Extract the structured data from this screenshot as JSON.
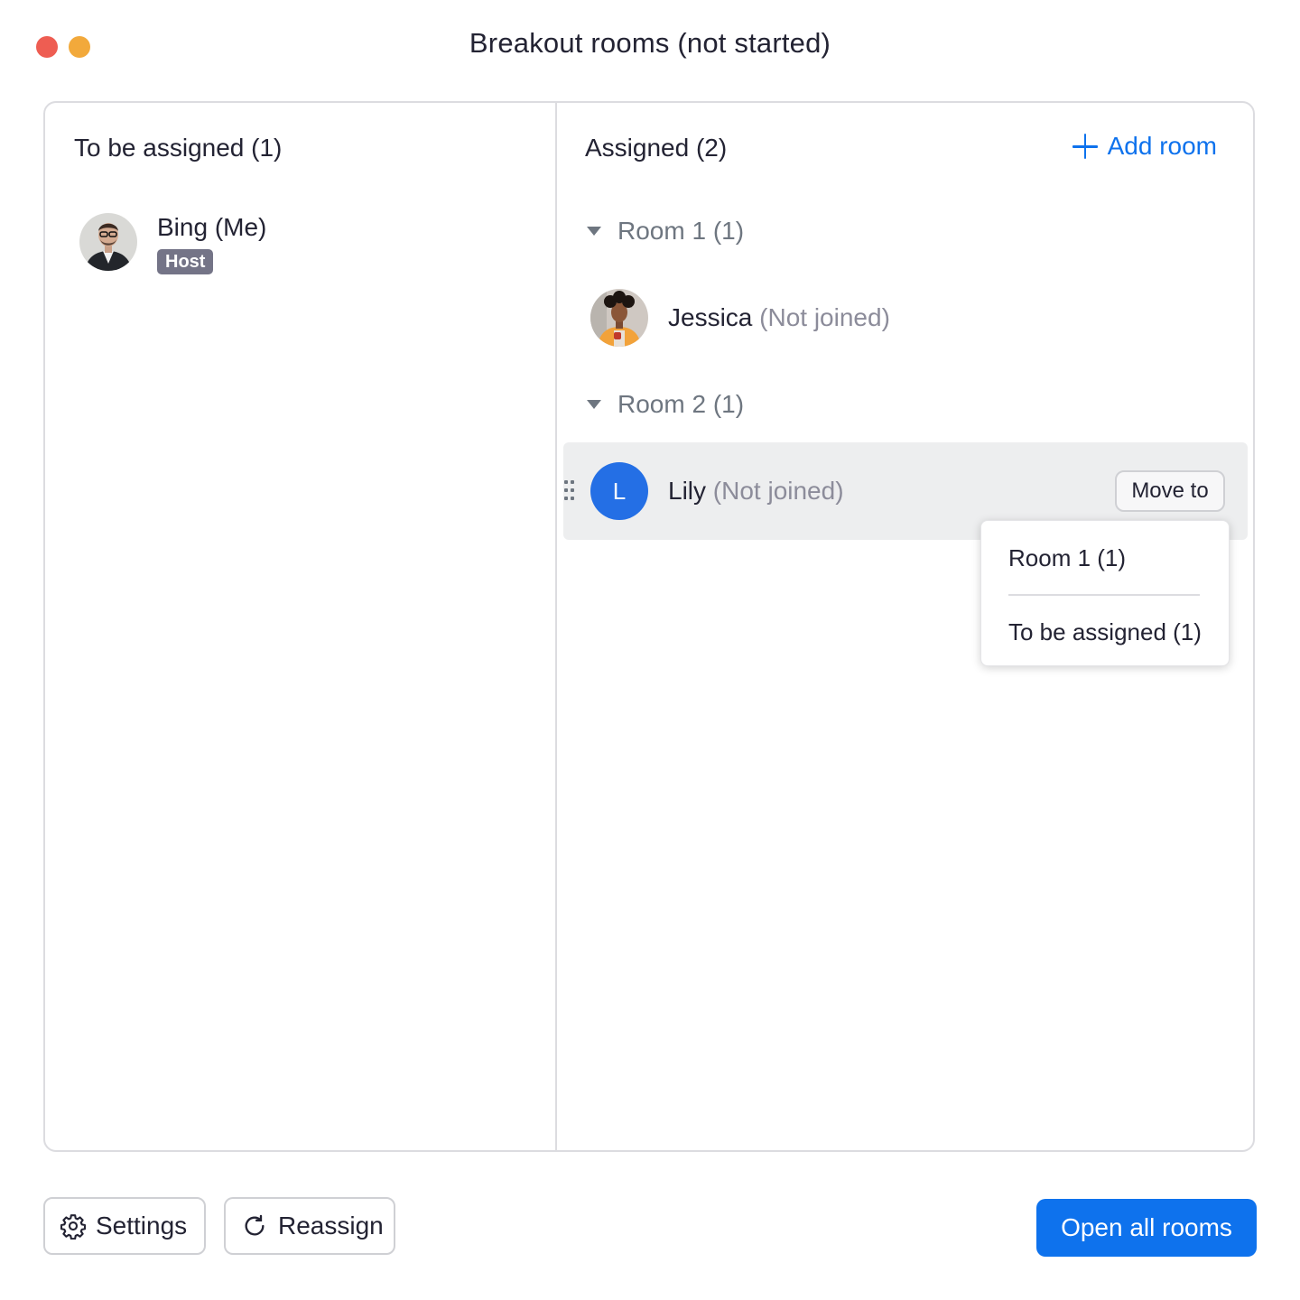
{
  "window": {
    "title": "Breakout rooms (not started)"
  },
  "left_column": {
    "title": "To be assigned (1)",
    "participants": [
      {
        "name": "Bing (Me)",
        "badge": "Host"
      }
    ]
  },
  "right_column": {
    "title": "Assigned (2)",
    "add_room_label": "Add room",
    "rooms": [
      {
        "label": "Room 1 (1)",
        "participants": [
          {
            "name": "Jessica",
            "status": "(Not joined)"
          }
        ]
      },
      {
        "label": "Room 2 (1)",
        "participants": [
          {
            "name": "Lily",
            "status": "(Not joined)",
            "initial": "L",
            "move_label": "Move to"
          }
        ]
      }
    ]
  },
  "move_menu": {
    "options": [
      "Room 1 (1)",
      "To be assigned (1)"
    ]
  },
  "footer": {
    "settings_label": "Settings",
    "reassign_label": "Reassign",
    "open_all_label": "Open all rooms"
  },
  "colors": {
    "accent": "#0e72ed",
    "letter_avatar": "#246fe5",
    "host_badge": "#747487",
    "close_light": "#ee5d52",
    "minimize_light": "#f2a93b"
  }
}
